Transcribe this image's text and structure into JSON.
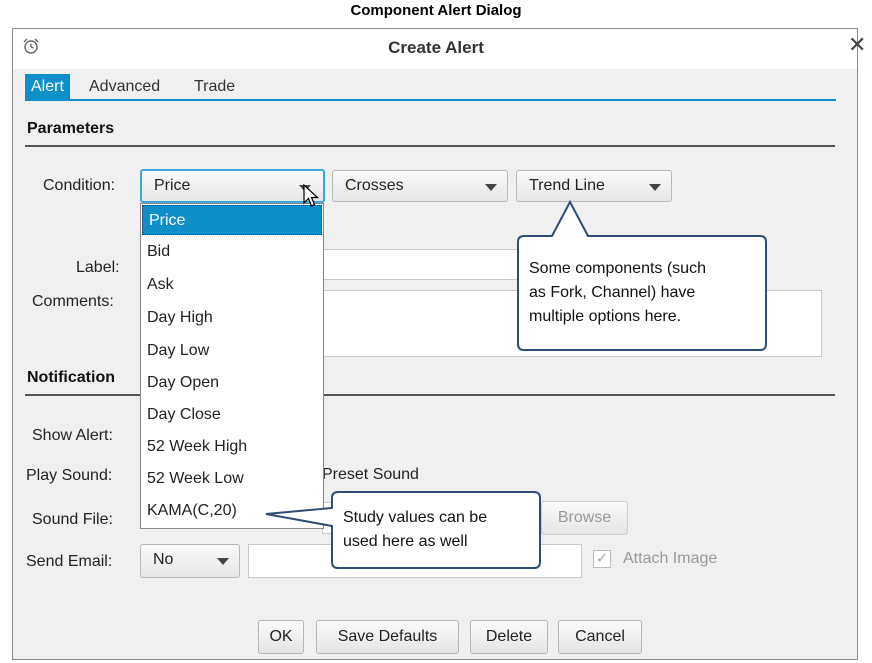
{
  "caption": "Component Alert Dialog",
  "dialog": {
    "title": "Create Alert",
    "close_icon": "close-icon",
    "title_icon": "alarm-clock-icon"
  },
  "tabs": [
    {
      "label": "Alert",
      "active": true
    },
    {
      "label": "Advanced",
      "active": false
    },
    {
      "label": "Trade",
      "active": false
    }
  ],
  "parameters": {
    "heading": "Parameters",
    "condition_label": "Condition:",
    "condition_source": "Price",
    "condition_operator": "Crosses",
    "condition_target": "Trend Line",
    "label_label": "Label:",
    "comments_label": "Comments:"
  },
  "source_options": [
    "Price",
    "Bid",
    "Ask",
    "Day High",
    "Day Low",
    "Day Open",
    "Day Close",
    "52 Week High",
    "52 Week Low",
    "KAMA(C,20)"
  ],
  "notifications": {
    "heading": "Notification",
    "show_alert_label": "Show Alert:",
    "play_sound_label": "Play Sound:",
    "preset_sound": "Preset Sound",
    "sound_file_label": "Sound File:",
    "browse_label": "Browse",
    "send_email_label": "Send Email:",
    "send_email_value": "No",
    "attach_image_label": "Attach Image"
  },
  "callouts": {
    "trend_line_note": [
      "Some components (such",
      "as Fork, Channel) have",
      "multiple options here."
    ],
    "study_note": [
      "Study values can be",
      "used here as well"
    ]
  },
  "buttons": {
    "ok": "OK",
    "save_defaults": "Save Defaults",
    "delete": "Delete",
    "cancel": "Cancel"
  },
  "colors": {
    "accent": "#0f8fc9",
    "callout_border": "#2e4d73"
  }
}
